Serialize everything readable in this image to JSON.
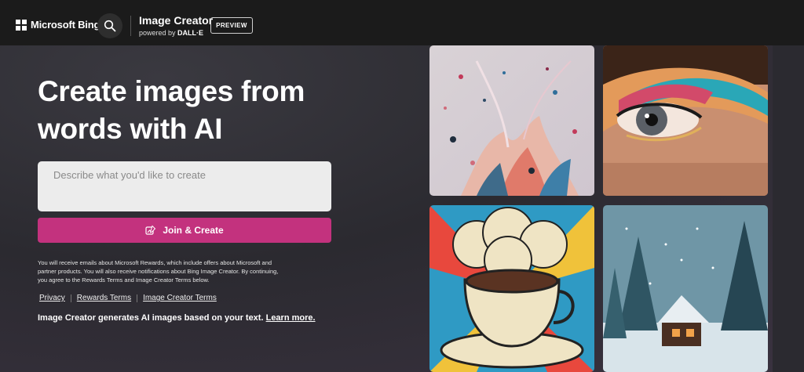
{
  "header": {
    "brand_name": "Microsoft Bing",
    "product_title": "Image Creator",
    "product_sub_prefix": "powered by",
    "product_sub_brand": "DALL·E",
    "badge": "PREVIEW"
  },
  "hero": {
    "headline": "Create images from words with AI",
    "prompt_placeholder": "Describe what you'd like to create",
    "prompt_value": "",
    "create_button_label": "Join & Create",
    "disclaimer": "You will receive emails about Microsoft Rewards, which include offers about Microsoft and partner products. You will also receive notifications about Bing Image Creator. By continuing, you agree to the Rewards Terms and Image Creator Terms below.",
    "links": [
      "Privacy",
      "Rewards Terms",
      "Image Creator Terms"
    ],
    "footer_text": "Image Creator generates AI images based on your text.",
    "footer_link": "Learn more."
  },
  "gallery": [
    {
      "name": "paint-splash-image"
    },
    {
      "name": "eye-makeup-image"
    },
    {
      "name": "coffee-cup-popart-image"
    },
    {
      "name": "snowy-cabin-image"
    }
  ],
  "colors": {
    "accent": "#c3327e",
    "topbar": "#1b1b1b",
    "background": "#2b2a30"
  }
}
